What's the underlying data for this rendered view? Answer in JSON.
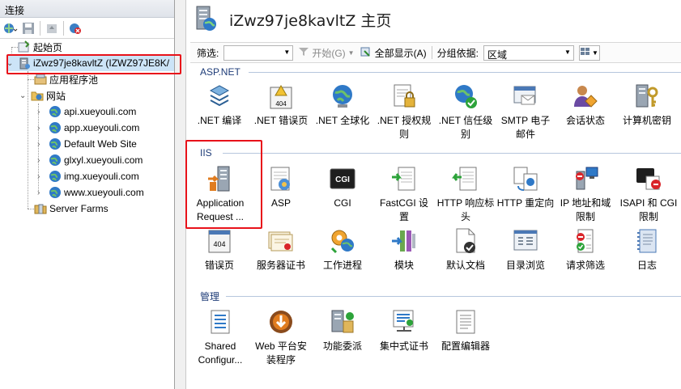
{
  "left_panel": {
    "header": "连接",
    "tree": [
      {
        "label": "起始页",
        "icon": "start-page-icon"
      },
      {
        "label": "iZwz97je8kavltZ (IZWZ97JE8K/",
        "icon": "server-icon"
      },
      {
        "label": "应用程序池",
        "icon": "app-pool-icon"
      },
      {
        "label": "网站",
        "icon": "sites-folder-icon"
      },
      {
        "label": "api.xueyouli.com",
        "icon": "globe-icon"
      },
      {
        "label": "app.xueyouli.com",
        "icon": "globe-icon"
      },
      {
        "label": "Default Web Site",
        "icon": "globe-icon"
      },
      {
        "label": "glxyl.xueyouli.com",
        "icon": "globe-icon"
      },
      {
        "label": "img.xueyouli.com",
        "icon": "globe-icon"
      },
      {
        "label": "www.xueyouli.com",
        "icon": "globe-icon"
      },
      {
        "label": "Server Farms",
        "icon": "server-farm-icon"
      }
    ]
  },
  "header": {
    "title": "iZwz97je8kavltZ 主页"
  },
  "filter_bar": {
    "filter_label": "筛选:",
    "start_label": "开始(G)",
    "show_all_label": "全部显示(A)",
    "group_by_label": "分组依据:",
    "group_value": "区域"
  },
  "sections": {
    "aspnet": {
      "title": "ASP.NET",
      "items": [
        {
          "line1": ".NET 编译",
          "line2": ""
        },
        {
          "line1": ".NET 错误页",
          "line2": ""
        },
        {
          "line1": ".NET 全球化",
          "line2": ""
        },
        {
          "line1": ".NET 授权规",
          "line2": "则"
        },
        {
          "line1": ".NET 信任级",
          "line2": "别"
        },
        {
          "line1": "SMTP 电子",
          "line2": "邮件"
        },
        {
          "line1": "会话状态",
          "line2": ""
        },
        {
          "line1": "计算机密钥",
          "line2": ""
        }
      ]
    },
    "iis": {
      "title": "IIS",
      "row1": [
        {
          "line1": "Application",
          "line2": "Request ..."
        },
        {
          "line1": "ASP",
          "line2": ""
        },
        {
          "line1": "CGI",
          "line2": ""
        },
        {
          "line1": "FastCGI 设",
          "line2": "置"
        },
        {
          "line1": "HTTP 响应标",
          "line2": "头"
        },
        {
          "line1": "HTTP 重定向",
          "line2": ""
        },
        {
          "line1": "IP 地址和域",
          "line2": "限制"
        },
        {
          "line1": "ISAPI 和 CGI",
          "line2": "限制"
        }
      ],
      "row2": [
        {
          "line1": "错误页",
          "line2": ""
        },
        {
          "line1": "服务器证书",
          "line2": ""
        },
        {
          "line1": "工作进程",
          "line2": ""
        },
        {
          "line1": "模块",
          "line2": ""
        },
        {
          "line1": "默认文档",
          "line2": ""
        },
        {
          "line1": "目录浏览",
          "line2": ""
        },
        {
          "line1": "请求筛选",
          "line2": ""
        },
        {
          "line1": "日志",
          "line2": ""
        }
      ]
    },
    "manage": {
      "title": "管理",
      "items": [
        {
          "line1": "Shared",
          "line2": "Configur..."
        },
        {
          "line1": "Web 平台安",
          "line2": "装程序"
        },
        {
          "line1": "功能委派",
          "line2": ""
        },
        {
          "line1": "集中式证书",
          "line2": ""
        },
        {
          "line1": "配置编辑器",
          "line2": ""
        }
      ]
    }
  },
  "icon_text": {
    "err404": "404",
    "cgi": "CGI"
  },
  "colors": {
    "highlight_border": "#e8121a",
    "selected_row": "#cce4f7",
    "section_title": "#1e3c78"
  }
}
